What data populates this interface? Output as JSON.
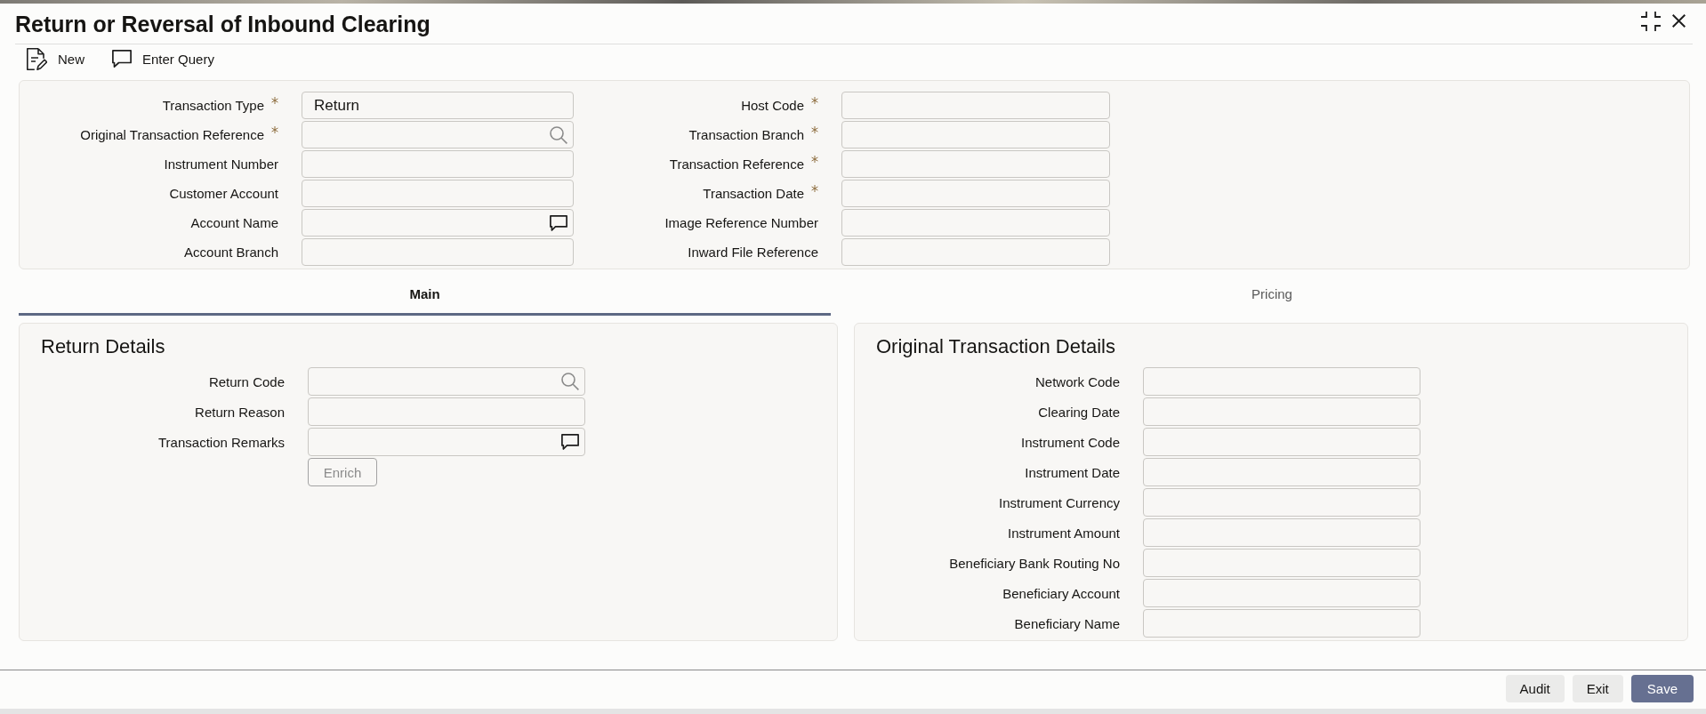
{
  "window": {
    "title": "Return or Reversal of Inbound Clearing"
  },
  "toolbar": [
    {
      "kind": "new",
      "label": "New"
    },
    {
      "kind": "query",
      "label": "Enter Query"
    }
  ],
  "header": {
    "left_fields": [
      {
        "label": "Transaction Type",
        "required": true,
        "kind": "text",
        "value": "Return"
      },
      {
        "label": "Original Transaction Reference",
        "required": true,
        "kind": "lookup"
      },
      {
        "label": "Instrument Number",
        "required": false,
        "kind": "text"
      },
      {
        "label": "Customer Account",
        "required": false,
        "kind": "text"
      },
      {
        "label": "Account Name",
        "required": false,
        "kind": "note"
      },
      {
        "label": "Account Branch",
        "required": false,
        "kind": "text"
      }
    ],
    "right_fields": [
      {
        "label": "Host Code",
        "required": true,
        "kind": "text"
      },
      {
        "label": "Transaction Branch",
        "required": true,
        "kind": "text"
      },
      {
        "label": "Transaction Reference",
        "required": true,
        "kind": "text"
      },
      {
        "label": "Transaction Date",
        "required": true,
        "kind": "text"
      },
      {
        "label": "Image Reference Number",
        "required": false,
        "kind": "text"
      },
      {
        "label": "Inward File Reference",
        "required": false,
        "kind": "text"
      }
    ]
  },
  "tabs": [
    {
      "label": "Main",
      "selected": true
    },
    {
      "label": "Pricing",
      "selected": false
    }
  ],
  "return_details": {
    "title": "Return Details",
    "fields": [
      {
        "label": "Return Code",
        "kind": "lookup"
      },
      {
        "label": "Return Reason",
        "kind": "text"
      },
      {
        "label": "Transaction Remarks",
        "kind": "note"
      }
    ],
    "enrich_button": {
      "label": "Enrich",
      "disabled": true
    }
  },
  "original_transaction_details": {
    "title": "Original Transaction Details",
    "fields": [
      {
        "label": "Network Code",
        "kind": "text"
      },
      {
        "label": "Clearing Date",
        "kind": "text"
      },
      {
        "label": "Instrument Code",
        "kind": "text"
      },
      {
        "label": "Instrument Date",
        "kind": "text"
      },
      {
        "label": "Instrument Currency",
        "kind": "text"
      },
      {
        "label": "Instrument Amount",
        "kind": "text"
      },
      {
        "label": "Beneficiary Bank Routing No",
        "kind": "text"
      },
      {
        "label": "Beneficiary Account",
        "kind": "text"
      },
      {
        "label": "Beneficiary Name",
        "kind": "text"
      }
    ]
  },
  "footer_buttons": [
    {
      "label": "Audit",
      "kind": "secondary"
    },
    {
      "label": "Exit",
      "kind": "secondary"
    },
    {
      "label": "Save",
      "kind": "primary"
    }
  ]
}
